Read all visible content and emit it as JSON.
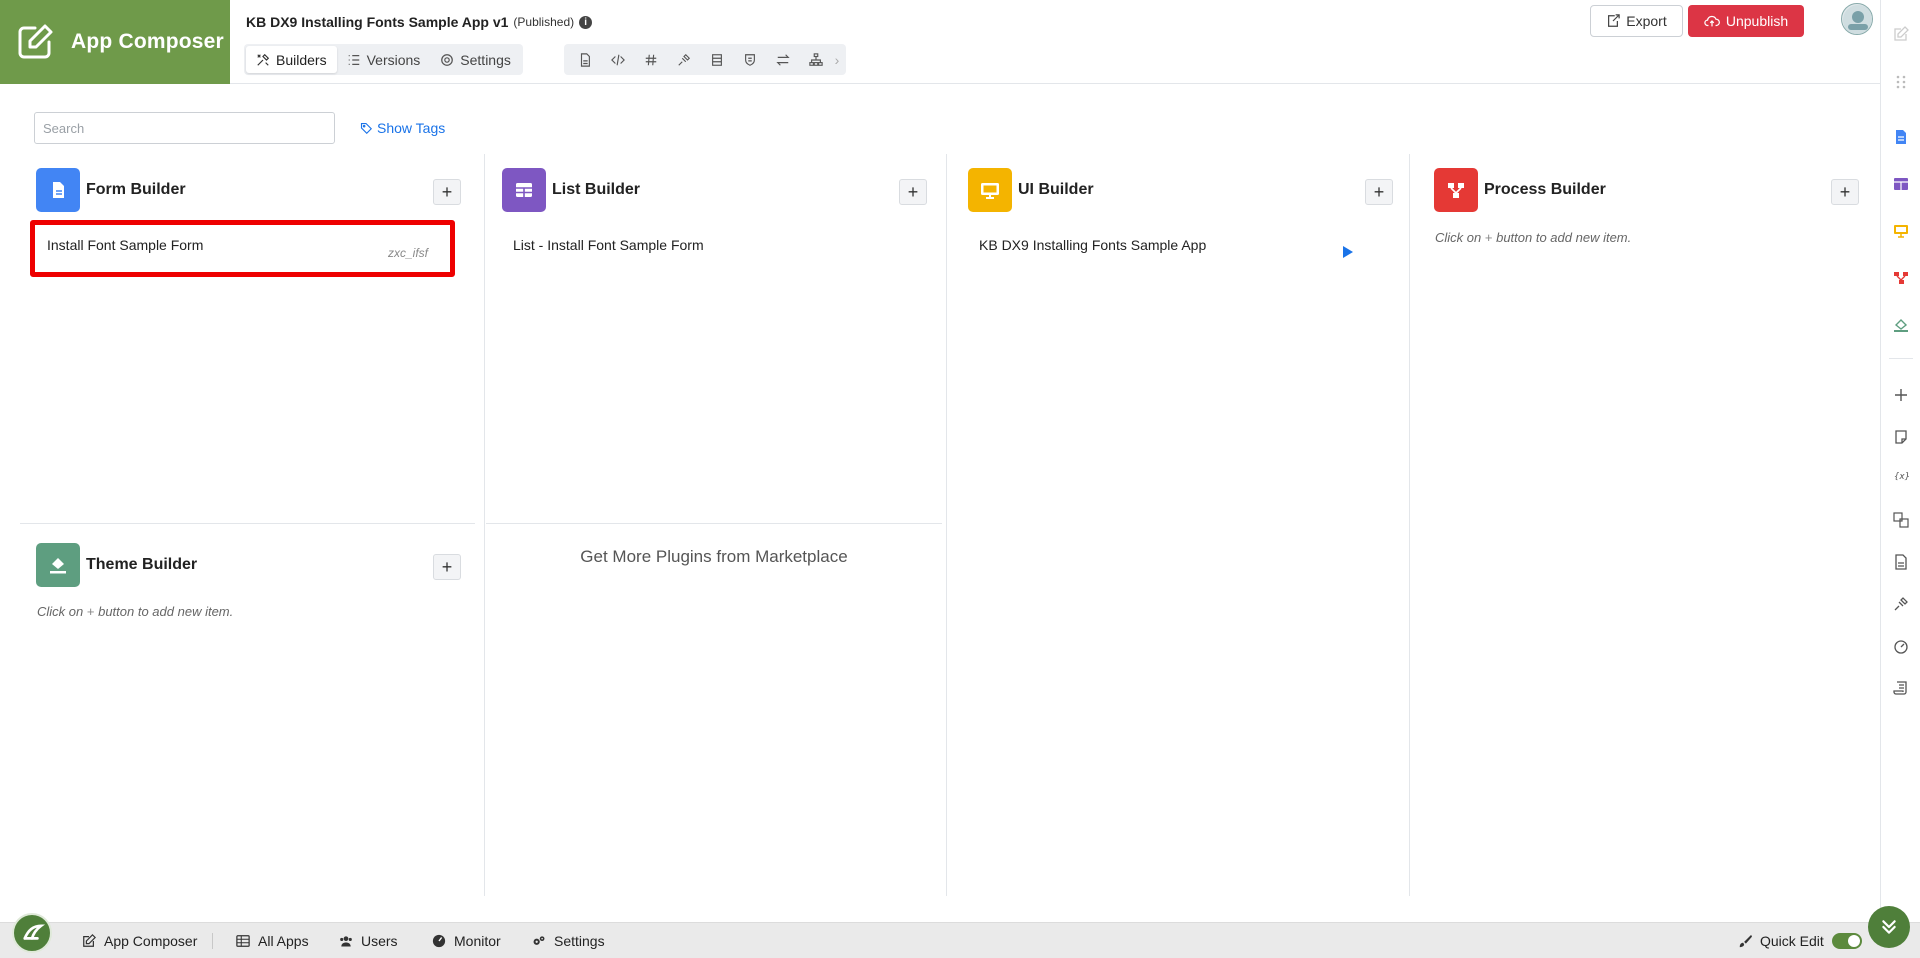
{
  "brand": {
    "name": "App Composer",
    "color": "#6f9a4a"
  },
  "app": {
    "title": "KB DX9 Installing Fonts Sample App v1",
    "status": "(Published)",
    "info_glyph": "i"
  },
  "tabs": [
    {
      "label": "Builders",
      "icon": "builders-icon",
      "active": true
    },
    {
      "label": "Versions",
      "icon": "versions-icon",
      "active": false
    },
    {
      "label": "Settings",
      "icon": "gear-icon",
      "active": false
    }
  ],
  "toolbar_icons": [
    "file-icon",
    "code-icon",
    "hash-icon",
    "plug-icon",
    "table-icon",
    "shield-icon",
    "swap-icon",
    "sitemap-icon"
  ],
  "actions": {
    "export": "Export",
    "unpublish": "Unpublish",
    "unpublish_color": "#dc3545"
  },
  "search": {
    "placeholder": "Search",
    "show_tags": "Show Tags"
  },
  "builders": {
    "form": {
      "title": "Form Builder",
      "color": "#4285f4",
      "item": "Install Font Sample Form",
      "item_tag": "zxc_ifsf"
    },
    "list": {
      "title": "List Builder",
      "color": "#7e57c2",
      "item": "List - Install Font Sample Form"
    },
    "ui": {
      "title": "UI Builder",
      "color": "#f4b400",
      "item": "KB DX9 Installing Fonts Sample App"
    },
    "process": {
      "title": "Process Builder",
      "color": "#e53935",
      "hint_before": "Click on",
      "hint_plus": "+",
      "hint_after": "button to add new item."
    },
    "theme": {
      "title": "Theme Builder",
      "color": "#5e9e80",
      "hint_before": "Click on",
      "hint_plus": "+",
      "hint_after": "button to add new item."
    }
  },
  "add_glyph": "+",
  "marketplace": "Get More Plugins from Marketplace",
  "footer": {
    "items": [
      {
        "label": "App Composer",
        "icon": "edit-icon"
      },
      {
        "label": "All Apps",
        "icon": "grid-icon"
      },
      {
        "label": "Users",
        "icon": "users-icon"
      },
      {
        "label": "Monitor",
        "icon": "gauge-icon"
      },
      {
        "label": "Settings",
        "icon": "gears-icon"
      }
    ],
    "quick_edit": "Quick Edit"
  },
  "highlight_color": "#ee0000"
}
